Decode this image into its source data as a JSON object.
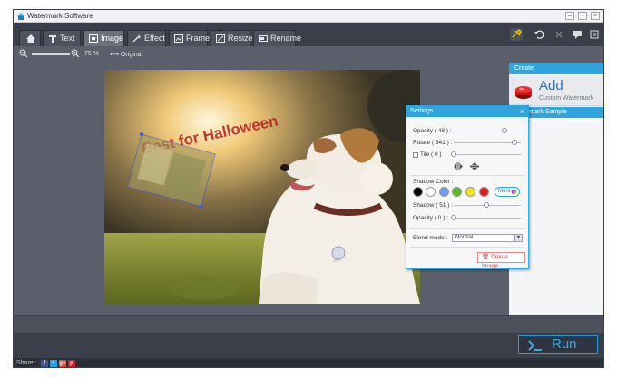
{
  "window": {
    "title": "Watermark Software"
  },
  "tabs": [
    {
      "label": ""
    },
    {
      "label": "Text"
    },
    {
      "label": "Image"
    },
    {
      "label": "Effect"
    },
    {
      "label": "Frame"
    },
    {
      "label": "Resize"
    },
    {
      "label": "Rename"
    }
  ],
  "zoom": {
    "percent": "75 %",
    "original_label": "Original",
    "level": 0.75
  },
  "canvas": {
    "watermark_text": "Best for Halloween"
  },
  "right_panel": {
    "create_header": "Create",
    "add_label": "Add",
    "add_sub": "Custom Watermark",
    "sample_header": "Watermark Sample"
  },
  "settings": {
    "title": "Settings",
    "close": "×",
    "opacity_label": "Opacity ( 48 ) :",
    "rotate_label": "Rotate ( 341 ) :",
    "tile_label": "Tile ( 0 )",
    "shadow_color_label": "Shadow Color :",
    "more_label": "More",
    "shadow_label": "Shadow ( 51 ) :",
    "opacity2_label": "Opacity ( 0 ) :",
    "blend_label": "Blend mode :",
    "blend_value": "Normal",
    "delete_label": "Delete Image",
    "values": {
      "opacity": 48,
      "rotate": 341,
      "tile": 0,
      "shadow": 51,
      "shadow_opacity": 0
    },
    "swatches": [
      "#000000",
      "#ffffff",
      "#6f9cf0",
      "#5db82a",
      "#f0e61a",
      "#e21b1b"
    ]
  },
  "run": {
    "label": "Run"
  },
  "share": {
    "label": "Share :",
    "icons": [
      "f",
      "t",
      "g+",
      "p"
    ]
  }
}
